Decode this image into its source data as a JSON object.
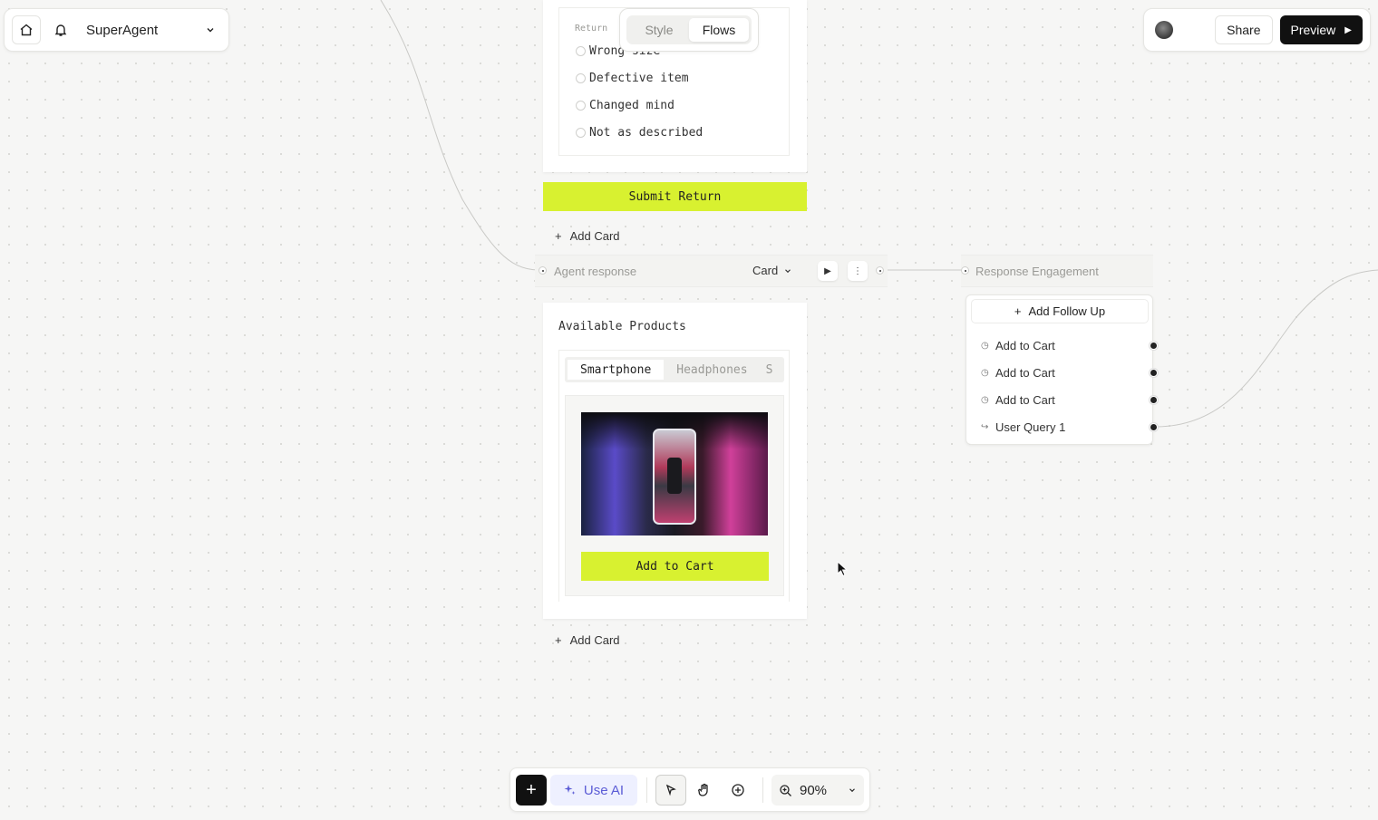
{
  "header": {
    "app_name": "SuperAgent",
    "icons": [
      "home-icon",
      "bell-icon",
      "chevron-down-icon"
    ]
  },
  "mode_toggle": {
    "tabs": [
      {
        "label": "Style",
        "active": false
      },
      {
        "label": "Flows",
        "active": true
      }
    ]
  },
  "actions": {
    "share_label": "Share",
    "preview_label": "Preview"
  },
  "return_card": {
    "label": "Return",
    "options": [
      "Wrong size",
      "Defective item",
      "Changed mind",
      "Not as described"
    ],
    "submit_label": "Submit Return"
  },
  "add_card_label": "Add Card",
  "agent_node": {
    "label": "Agent response",
    "type_label": "Card"
  },
  "engagement_node": {
    "label": "Response Engagement",
    "add_follow_up_label": "Add Follow Up",
    "items": [
      {
        "icon": "clock-icon",
        "label": "Add to Cart"
      },
      {
        "icon": "clock-icon",
        "label": "Add to Cart"
      },
      {
        "icon": "clock-icon",
        "label": "Add to Cart"
      },
      {
        "icon": "return-arrow-icon",
        "label": "User Query 1"
      }
    ]
  },
  "products_card": {
    "title": "Available Products",
    "tabs": [
      {
        "label": "Smartphone",
        "active": true
      },
      {
        "label": "Headphones",
        "active": false
      },
      {
        "label": "S",
        "active": false
      }
    ],
    "add_to_cart_label": "Add to Cart"
  },
  "toolbar": {
    "use_ai_label": "Use AI",
    "zoom_label": "90%"
  },
  "colors": {
    "accent_lime": "#d8f130",
    "ai_purple": "#5b5cd6",
    "primary_dark": "#111111"
  }
}
